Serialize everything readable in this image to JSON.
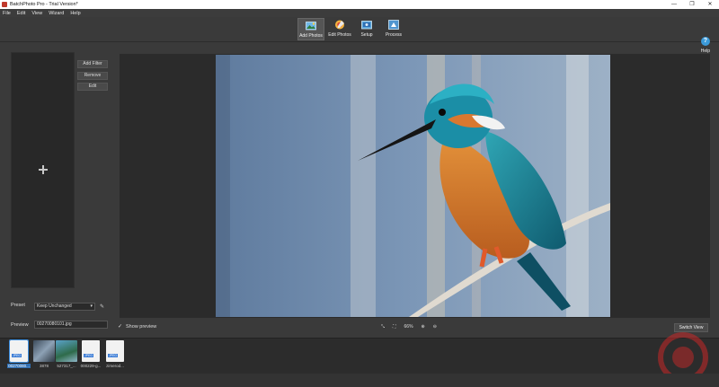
{
  "window": {
    "title": "BatchPhoto Pro - Trial Version*",
    "controls": [
      "—",
      "❐",
      "✕"
    ]
  },
  "menu": [
    "File",
    "Edit",
    "View",
    "Wizard",
    "Help"
  ],
  "toolbar": {
    "add_photos": "Add Photos",
    "edit_photos": "Edit Photos",
    "setup": "Setup",
    "process": "Process",
    "help": "Help",
    "help_glyph": "?"
  },
  "sidebar": {
    "add_filter": "Add Filter",
    "remove": "Remove",
    "edit": "Edit"
  },
  "preset": {
    "label": "Preset",
    "value": "Keep Unchanged"
  },
  "preview": {
    "label": "Preview",
    "value": "00270080101.jpg"
  },
  "show_preview": {
    "label": "Show preview",
    "checked": true
  },
  "zoom": {
    "fit_glyph": "⤡",
    "full_glyph": "⛶",
    "percent": "66%",
    "zoom_in_glyph": "⊕",
    "zoom_out_glyph": "⊖"
  },
  "switch_view": "Switch View",
  "thumbnails": [
    {
      "caption": "00270080...",
      "kind": "photo",
      "selected": true
    },
    {
      "caption": "3878",
      "kind": "photo2",
      "selected": false
    },
    {
      "caption": "527317_...",
      "kind": "photo3",
      "selected": false
    },
    {
      "caption": "000229-g...",
      "kind": "jpeg",
      "selected": false
    },
    {
      "caption": "zimerod...",
      "kind": "jpeg",
      "selected": false
    }
  ],
  "colors": {
    "accent": "#3b9ad9",
    "selection": "#2f6fb3",
    "panel": "#2b2b2b"
  }
}
